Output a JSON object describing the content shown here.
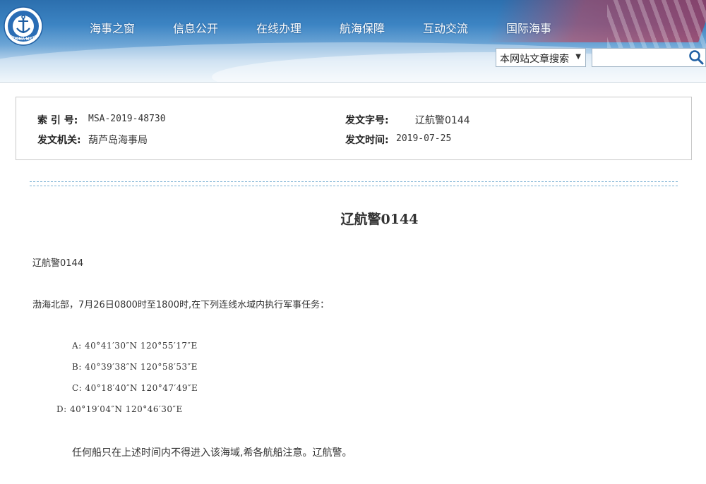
{
  "header": {
    "logo": {
      "name": "china-msa-logo",
      "text": "CHINA MSA"
    },
    "nav": [
      "海事之窗",
      "信息公开",
      "在线办理",
      "航海保障",
      "互动交流",
      "国际海事"
    ],
    "search": {
      "scope_selected": "本网站文章搜索",
      "input_value": "",
      "button_icon": "search-icon"
    }
  },
  "meta": {
    "index_label": "索 引 号:",
    "index_value": "MSA-2019-48730",
    "doc_no_label": "发文字号:",
    "doc_no_value": "辽航警0144",
    "issuer_label": "发文机关:",
    "issuer_value": "葫芦岛海事局",
    "date_label": "发文时间:",
    "date_value": "2019-07-25"
  },
  "article": {
    "title": "辽航警0144",
    "ref": "辽航警0144",
    "intro": "渤海北部，7月26日0800时至1800时,在下列连线水域内执行军事任务：",
    "points": [
      "A:  40°41′30″N  120°55′17″E",
      "B:  40°39′38″N  120°58′53″E",
      "C:  40°18′40″N  120°47′49″E",
      "D:  40°19′04″N  120°46′30″E"
    ],
    "closing": "任何船只在上述时间内不得进入该海域,希各航船注意。辽航警。"
  },
  "colors": {
    "header_blue": "#3c84c3",
    "divider": "#7fb3d4",
    "border": "#c8c8c8"
  }
}
